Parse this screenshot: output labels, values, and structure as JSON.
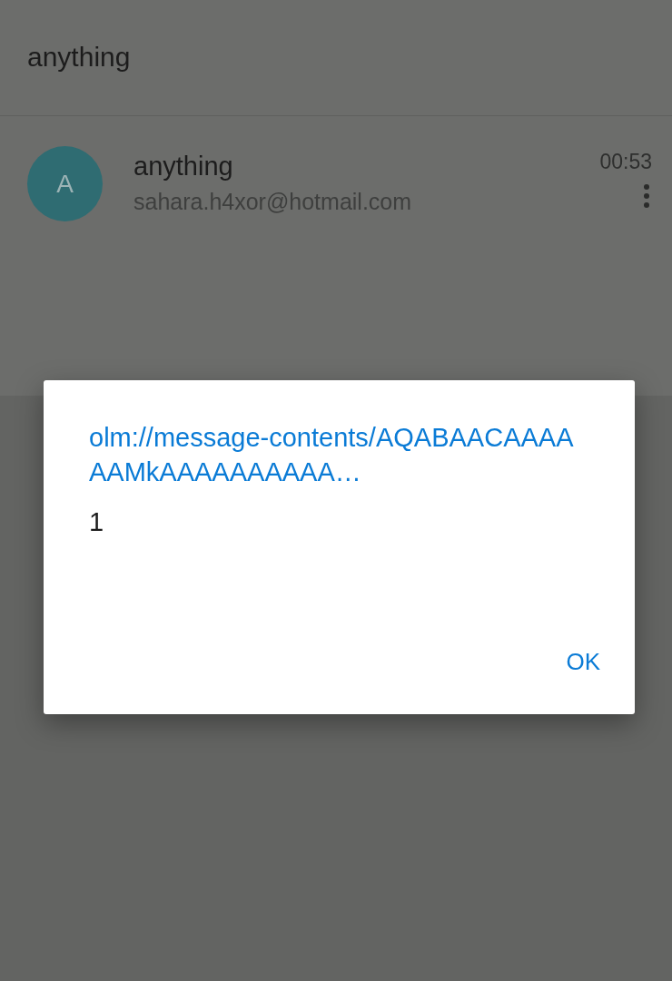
{
  "header": {
    "title": "anything"
  },
  "messages": [
    {
      "avatar": "A",
      "name": "anything",
      "email": "sahara.h4xor@hotmail.com",
      "time": "00:53"
    }
  ],
  "dialog": {
    "title": "olm://message-contents/AQABAACAAAAAAMkAAAAAAAAAA…",
    "message": "1",
    "buttons": [
      "OK"
    ]
  }
}
